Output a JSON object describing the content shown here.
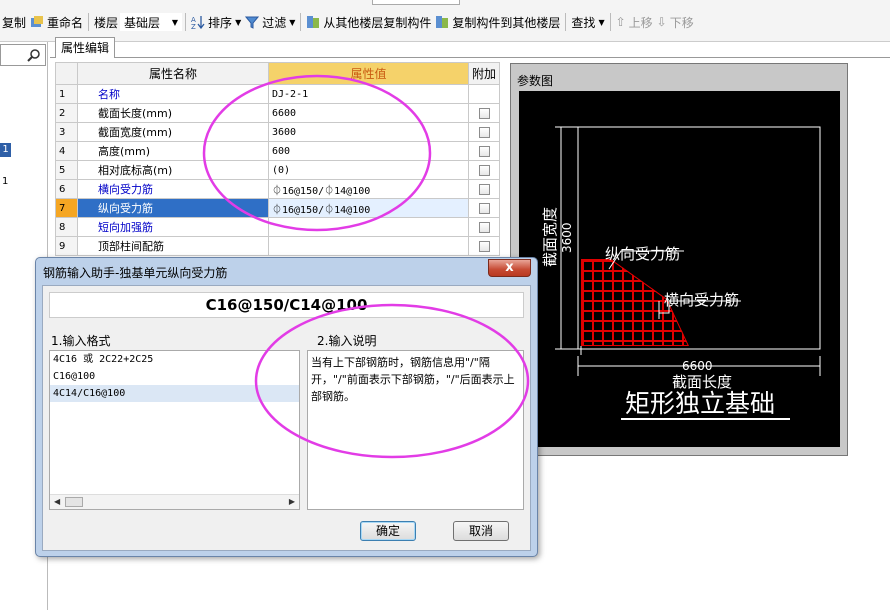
{
  "toolbar": {
    "copy": "复制",
    "rename": "重命名",
    "floor_label": "楼层",
    "floor_value": "基础层",
    "sort": "排序",
    "filter": "过滤",
    "copy_from_other": "从其他楼层复制构件",
    "copy_to_other": "复制构件到其他楼层",
    "find": "查找",
    "move_up": "上移",
    "move_down": "下移"
  },
  "leftstrip": {
    "selected_number": "1",
    "second_number": "1"
  },
  "panel": {
    "tab": "属性编辑",
    "columns": [
      "属性名称",
      "属性值",
      "附加"
    ],
    "rows": [
      {
        "n": "1",
        "name": "名称",
        "value": "DJ-2-1"
      },
      {
        "n": "2",
        "name": "截面长度(mm)",
        "value": "6600"
      },
      {
        "n": "3",
        "name": "截面宽度(mm)",
        "value": "3600"
      },
      {
        "n": "4",
        "name": "高度(mm)",
        "value": "600"
      },
      {
        "n": "5",
        "name": "相对底标高(m)",
        "value": "(0)"
      },
      {
        "n": "6",
        "name": "横向受力筋",
        "value": "⏀16@150/⏀14@100"
      },
      {
        "n": "7",
        "name": "纵向受力筋",
        "value": "⏀16@150/⏀14@100"
      },
      {
        "n": "8",
        "name": "短向加强筋",
        "value": ""
      },
      {
        "n": "9",
        "name": "顶部柱间配筋",
        "value": ""
      }
    ]
  },
  "param_figure": {
    "title": "参数图",
    "width_label": "截面宽度",
    "width_value": "3600",
    "length_value": "6600",
    "length_label": "截面长度",
    "longitudinal_label": "纵向受力筋",
    "transverse_label": "横向受力筋",
    "caption": "矩形独立基础"
  },
  "dialog": {
    "title": "钢筋输入助手-独基单元纵向受力筋",
    "close": "x",
    "preview": "C16@150/C14@100",
    "format_label": "1.输入格式",
    "explain_label": "2.输入说明",
    "formats": [
      "4C16 或 2C22+2C25",
      "C16@100",
      "4C14/C16@100"
    ],
    "description": "当有上下部钢筋时，钢筋信息用\"/\"隔开，\"/\"前面表示下部钢筋，\"/\"后面表示上部钢筋。",
    "ok": "确定",
    "cancel": "取消"
  },
  "colors": {
    "annotation": "#e23ce6",
    "selection": "#2f6fc6",
    "rebar": "#e00000"
  }
}
